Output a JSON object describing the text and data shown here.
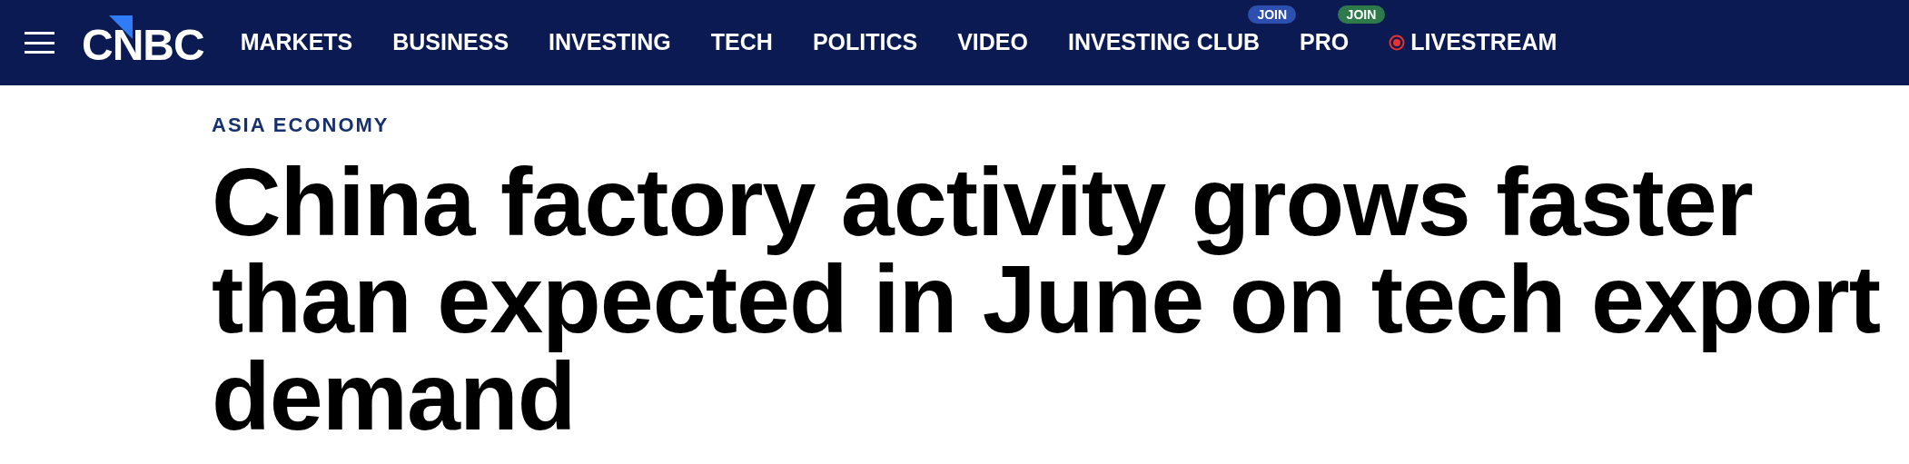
{
  "header": {
    "logo": "CNBC",
    "nav": [
      {
        "label": "MARKETS"
      },
      {
        "label": "BUSINESS"
      },
      {
        "label": "INVESTING"
      },
      {
        "label": "TECH"
      },
      {
        "label": "POLITICS"
      },
      {
        "label": "VIDEO"
      },
      {
        "label": "INVESTING CLUB",
        "badge": {
          "text": "JOIN",
          "color": "#2d4fb0"
        }
      },
      {
        "label": "PRO",
        "badge": {
          "text": "JOIN",
          "color": "#2e7a4a"
        }
      },
      {
        "label": "LIVESTREAM",
        "live": true
      }
    ]
  },
  "article": {
    "category": "ASIA ECONOMY",
    "headline": "China factory activity grows faster than expected in June on tech export demand"
  }
}
